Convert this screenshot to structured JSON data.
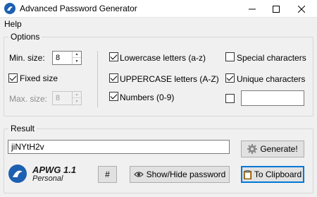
{
  "window": {
    "title": "Advanced Password Generator",
    "app_icon": "apwg-logo-icon",
    "controls": [
      "minimize-icon",
      "maximize-icon",
      "close-icon"
    ]
  },
  "menu": {
    "items": [
      "Help"
    ]
  },
  "options": {
    "group_label": "Options",
    "min_size": {
      "label": "Min. size:",
      "value": "8"
    },
    "fixed_size": {
      "label": "Fixed size",
      "checked": true
    },
    "max_size": {
      "label": "Max. size:",
      "value": "8",
      "disabled": true
    },
    "lowercase": {
      "label": "Lowercase letters (a-z)",
      "checked": true
    },
    "uppercase": {
      "label": "UPPERCASE letters (A-Z)",
      "checked": true
    },
    "numbers": {
      "label": "Numbers (0-9)",
      "checked": true
    },
    "special": {
      "label": "Special characters",
      "checked": false
    },
    "unique": {
      "label": "Unique characters",
      "checked": true
    },
    "custom": {
      "checked": false,
      "value": ""
    }
  },
  "result": {
    "group_label": "Result",
    "password": "jiNYtH2v",
    "generate_label": "Generate!",
    "hash_label": "#",
    "show_hide_label": "Show/Hide password",
    "clipboard_label": "To Clipboard"
  },
  "branding": {
    "name": "APWG 1.1",
    "edition": "Personal"
  },
  "colors": {
    "accent": "#0078d7",
    "logo": "#1d5fb0",
    "disabled_text": "#8d8d8d"
  }
}
